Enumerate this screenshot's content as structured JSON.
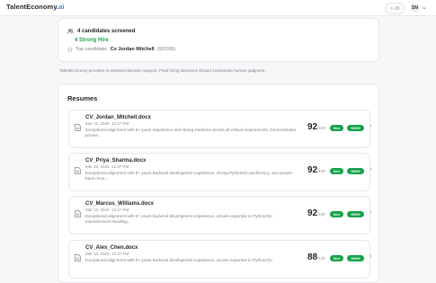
{
  "header": {
    "brand_main": "TalentEconomy.",
    "brand_suffix": "ai",
    "credits": "20",
    "avatar_initials": "SN"
  },
  "summary": {
    "candidates": "4 candidates screened",
    "strong_hire": "4 Strong Hire",
    "top_label": "Top candidate:",
    "top_name": "Cv Jordan Mitchell",
    "top_score": "(92/100)"
  },
  "disclaimer": "TalentEconomy provides AI-assisted decision support. Final hiring decisions should incorporate human judgment.",
  "resumes": {
    "title": "Resumes",
    "items": [
      {
        "file": "CV_Jordan_Mitchell.docx",
        "date": "Mar 16, 2026, 12:37 PM",
        "desc": "Exceptional alignment with 8+ years experience and strong evidence across all critical requirements. Demonstrates proven...",
        "score": "92",
        "out_of": "/100",
        "badge1": "hire",
        "badge2": "HIGH"
      },
      {
        "file": "CV_Priya_Sharma.docx",
        "date": "Mar 16, 2026, 12:37 PM",
        "desc": "Exceptional alignment with 8+ years backend development experience, strong Python/Go proficiency, and proven track recor...",
        "score": "92",
        "out_of": "/100",
        "badge1": "hire",
        "badge2": "HIGH"
      },
      {
        "file": "CV_Marcus_Williams.docx",
        "date": "Mar 16, 2026, 12:37 PM",
        "desc": "Exceptional alignment with 8+ years backend development experience, proven expertise in Python/Go microservices handling...",
        "score": "92",
        "out_of": "/100",
        "badge1": "hire",
        "badge2": "HIGH"
      },
      {
        "file": "CV_Alex_Chen.docx",
        "date": "Mar 16, 2026, 12:37 PM",
        "desc": "Exceptional alignment with 8+ years backend development experience, proven expertise in Python/Go",
        "score": "88",
        "out_of": "/100",
        "badge1": "hire",
        "badge2": "HIGH"
      }
    ]
  }
}
